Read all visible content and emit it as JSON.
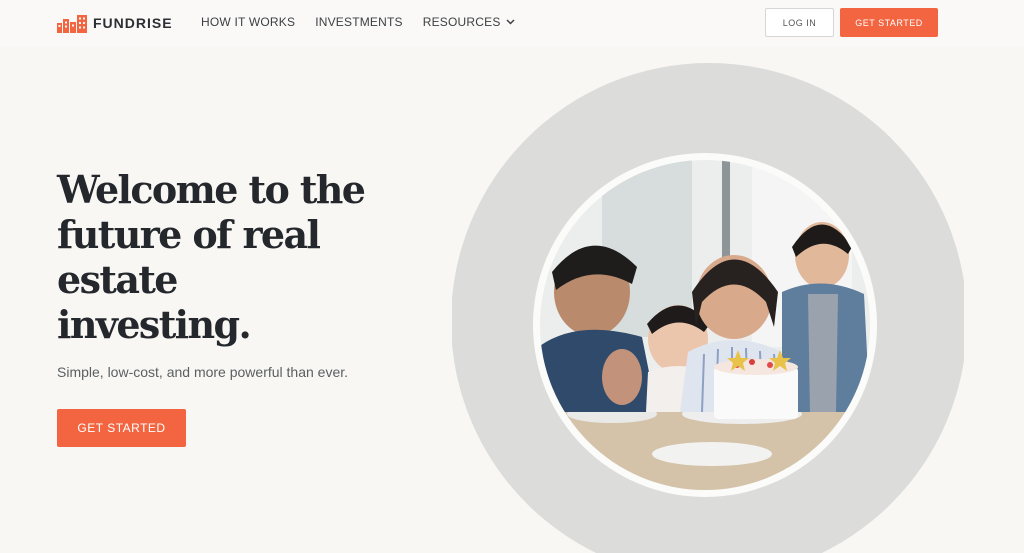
{
  "brand": {
    "name": "FUNDRISE",
    "accent_color": "#f26540"
  },
  "nav": {
    "items": [
      {
        "label": "HOW IT WORKS"
      },
      {
        "label": "INVESTMENTS"
      },
      {
        "label": "RESOURCES",
        "icon": "chevron-down-icon"
      }
    ]
  },
  "header": {
    "login_label": "LOG IN",
    "cta_label": "GET STARTED"
  },
  "hero": {
    "title": "Welcome to the future of real estate investing.",
    "subtitle": "Simple, low-cost, and more powerful than ever.",
    "cta_label": "GET STARTED"
  }
}
